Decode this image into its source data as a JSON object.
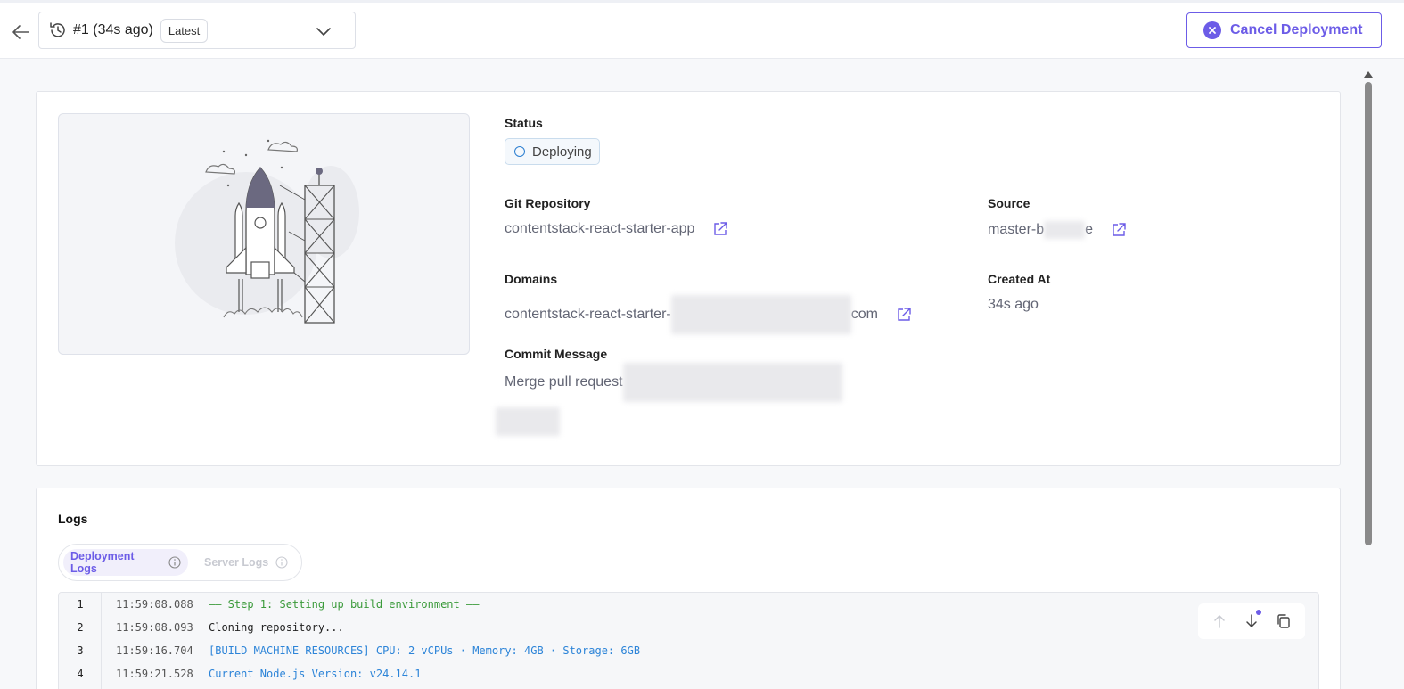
{
  "header": {
    "version_label": "#1 (34s ago)",
    "version_badge": "Latest",
    "cancel_label": "Cancel Deployment"
  },
  "overview": {
    "status": {
      "label": "Status",
      "value": "Deploying"
    },
    "git_repository": {
      "label": "Git Repository",
      "value": "contentstack-react-starter-app"
    },
    "source": {
      "label": "Source",
      "value_prefix": "master-b",
      "value_suffix": "e"
    },
    "domains": {
      "label": "Domains",
      "value_prefix": "contentstack-react-starter-",
      "value_suffix": "com"
    },
    "created_at": {
      "label": "Created At",
      "value": "34s ago"
    },
    "commit_message": {
      "label": "Commit Message",
      "value_prefix": "Merge pull request "
    }
  },
  "logs": {
    "title": "Logs",
    "tabs": [
      {
        "label": "Deployment Logs",
        "active": true
      },
      {
        "label": "Server Logs",
        "active": false
      }
    ],
    "lines": [
      {
        "n": "1",
        "time": "11:59:08.088",
        "text": "—— Step 1: Setting up build environment ——",
        "style": "green"
      },
      {
        "n": "2",
        "time": "11:59:08.093",
        "text": "Cloning repository...",
        "style": "plain"
      },
      {
        "n": "3",
        "time": "11:59:16.704",
        "text": "[BUILD MACHINE RESOURCES]  CPU: 2 vCPUs · Memory: 4GB · Storage: 6GB",
        "style": "blue"
      },
      {
        "n": "4",
        "time": "11:59:21.528",
        "text": "Current Node.js Version: v24.14.1",
        "style": "blue"
      }
    ]
  },
  "colors": {
    "accent": "#6c5ce7",
    "status_ring": "#2c7fd1",
    "log_green": "#3a9a3a",
    "log_blue": "#2c84d8"
  },
  "icons": {
    "back": "arrow-left-icon",
    "history": "history-icon",
    "chevron": "chevron-down-icon",
    "cancel": "close-circle-icon",
    "external": "external-link-icon",
    "info": "info-icon",
    "scroll_up": "arrow-up-icon",
    "scroll_down": "arrow-down-icon",
    "copy": "copy-icon"
  }
}
